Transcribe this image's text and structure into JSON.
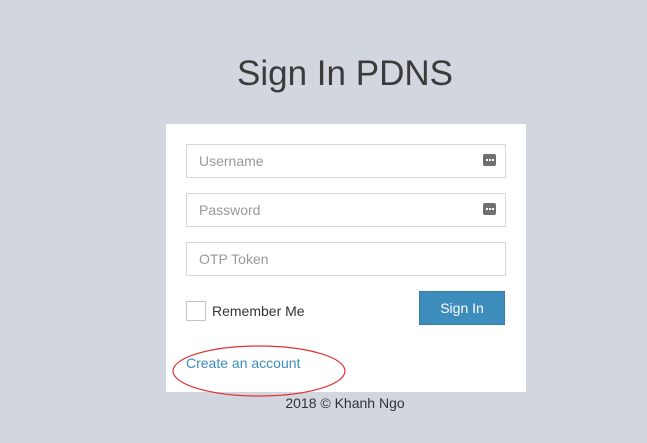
{
  "page": {
    "title": "Sign In PDNS"
  },
  "form": {
    "username_placeholder": "Username",
    "password_placeholder": "Password",
    "otp_placeholder": "OTP Token",
    "remember_label": "Remember Me",
    "signin_label": "Sign In",
    "create_account_label": "Create an account"
  },
  "footer": {
    "text": "2018 © Khanh Ngo"
  },
  "colors": {
    "background": "#d2d6de",
    "primary": "#3c8dbc",
    "annotation": "#e03030"
  },
  "icons": {
    "username_field_icon": "keyboard-icon",
    "password_field_icon": "keyboard-icon"
  }
}
